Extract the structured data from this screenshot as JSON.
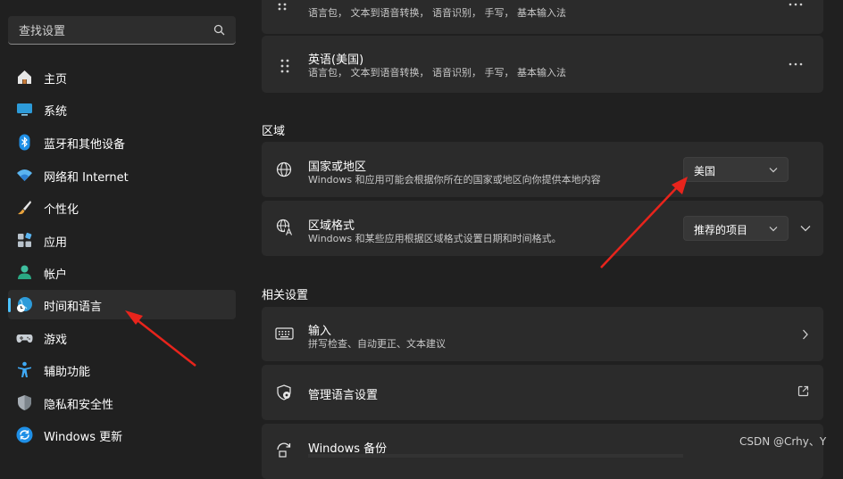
{
  "search": {
    "placeholder": "查找设置"
  },
  "sidebar": {
    "items": [
      {
        "label": "主页"
      },
      {
        "label": "系统"
      },
      {
        "label": "蓝牙和其他设备"
      },
      {
        "label": "网络和 Internet"
      },
      {
        "label": "个性化"
      },
      {
        "label": "应用"
      },
      {
        "label": "帐户"
      },
      {
        "label": "时间和语言"
      },
      {
        "label": "游戏"
      },
      {
        "label": "辅助功能"
      },
      {
        "label": "隐私和安全性"
      },
      {
        "label": "Windows 更新"
      }
    ],
    "selected_index": 7
  },
  "languages": {
    "items": [
      {
        "name": "",
        "desc": "语言包， 文本到语音转换， 语音识别， 手写， 基本输入法"
      },
      {
        "name": "英语(美国)",
        "desc": "语言包， 文本到语音转换， 语音识别， 手写， 基本输入法"
      }
    ]
  },
  "region": {
    "heading": "区域",
    "country": {
      "title": "国家或地区",
      "desc": "Windows 和应用可能会根据你所在的国家或地区向你提供本地内容",
      "value": "美国"
    },
    "format": {
      "title": "区域格式",
      "desc": "Windows 和某些应用根据区域格式设置日期和时间格式。",
      "value": "推荐的项目"
    }
  },
  "related": {
    "heading": "相关设置",
    "input": {
      "title": "输入",
      "desc": "拼写检查、自动更正、文本建议"
    },
    "manage": {
      "title": "管理语言设置"
    },
    "backup": {
      "title": "Windows 备份"
    }
  },
  "watermark": "CSDN @Crhy、Y",
  "colors": {
    "accent": "#4cc2ff",
    "annotation_arrow": "#e8241c",
    "card_bg": "#2b2b2b",
    "window_bg": "#202020"
  }
}
